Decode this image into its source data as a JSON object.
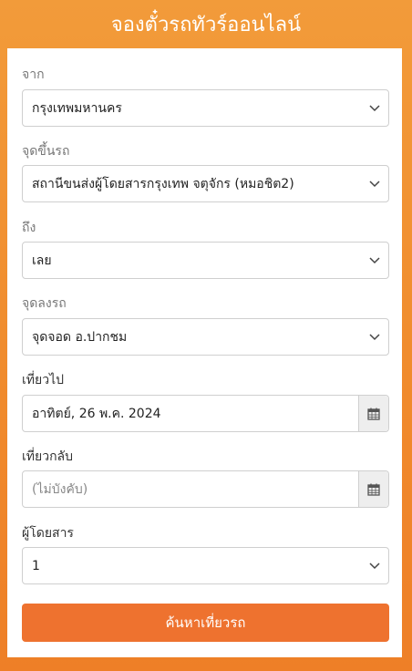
{
  "header": {
    "title": "จองตั๋วรถทัวร์ออนไลน์"
  },
  "form": {
    "from": {
      "label": "จาก",
      "value": "กรุงเทพมหานคร"
    },
    "board": {
      "label": "จุดขึ้นรถ",
      "value": "สถานีขนส่งผู้โดยสารกรุงเทพ จตุจักร (หมอชิต2)"
    },
    "to": {
      "label": "ถึง",
      "value": "เลย"
    },
    "dropoff": {
      "label": "จุดลงรถ",
      "value": "จุดจอด อ.ปากชม"
    },
    "depart": {
      "label": "เที่ยวไป",
      "value": "อาทิตย์, 26 พ.ค. 2024"
    },
    "return": {
      "label": "เที่ยวกลับ",
      "placeholder": "(ไม่บังคับ)"
    },
    "passengers": {
      "label": "ผู้โดยสาร",
      "value": "1"
    },
    "submit_label": "ค้นหาเที่ยวรถ"
  },
  "icons": {
    "chevron": "chevron-down-icon",
    "calendar": "calendar-icon"
  },
  "colors": {
    "background": "#f29b3a",
    "button": "#ee722f",
    "card": "#ffffff"
  }
}
